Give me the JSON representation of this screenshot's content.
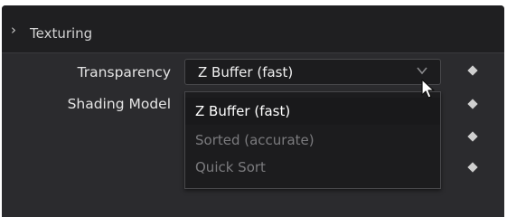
{
  "section": {
    "title": "Texturing",
    "chevron_icon": "chevron-right-icon"
  },
  "transparency": {
    "label": "Transparency",
    "selected_value": "Z Buffer (fast)",
    "options": [
      {
        "label": "Z Buffer (fast)",
        "state": "selected"
      },
      {
        "label": "Sorted (accurate)",
        "state": "disabled"
      },
      {
        "label": "Quick Sort",
        "state": "disabled"
      }
    ]
  },
  "shading_model": {
    "label": "Shading Model"
  },
  "icons": {
    "keyframe": "keyframe-diamond-icon",
    "cursor": "mouse-pointer-icon",
    "dropdown_arrow": "chevron-down-icon"
  },
  "colors": {
    "panel_bg": "#2b2b2e",
    "header_bg": "#1f1f21",
    "field_bg": "#1c1c1e",
    "disabled_text": "#7b7b7e",
    "text": "#e4e4e4"
  }
}
